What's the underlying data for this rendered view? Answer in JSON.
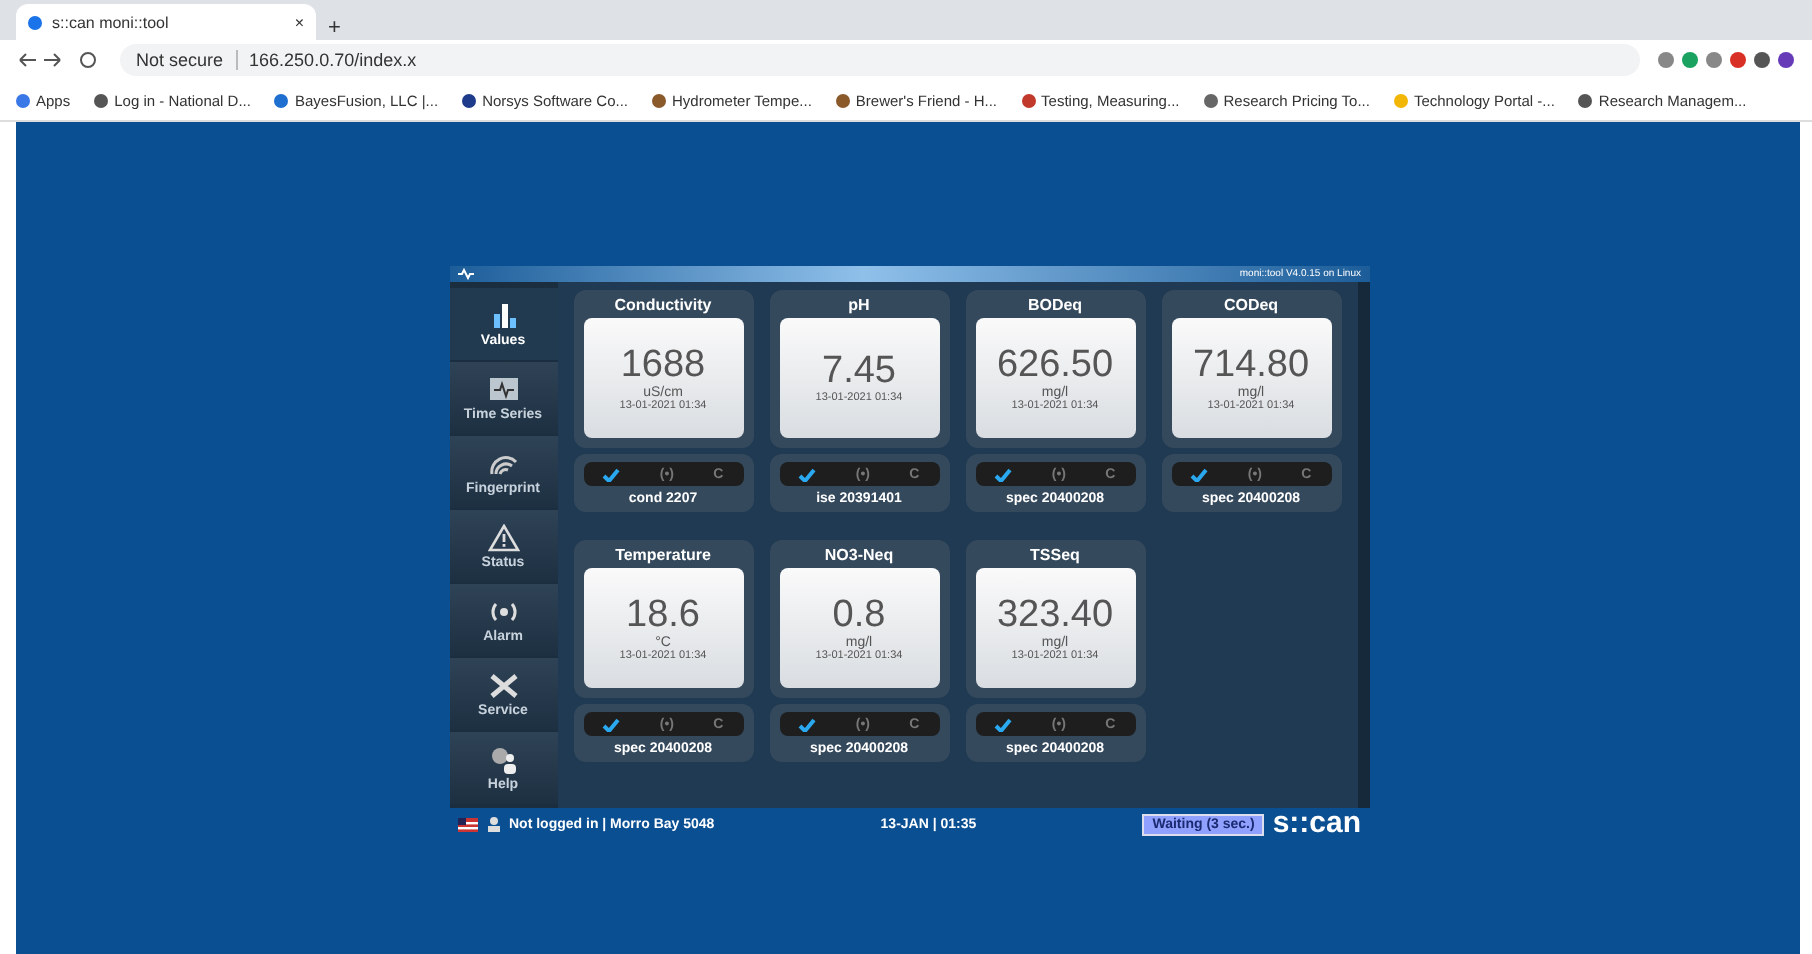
{
  "browser": {
    "tab_title": "s::can moni::tool",
    "tab_close": "×",
    "new_tab": "+",
    "security": "Not secure",
    "url": "166.250.0.70/index.x",
    "bookmarks": [
      "Apps",
      "Log in - National D...",
      "BayesFusion, LLC |...",
      "Norsys Software Co...",
      "Hydrometer Tempe...",
      "Brewer's Friend - H...",
      "Testing, Measuring...",
      "Research Pricing To...",
      "Technology Portal -...",
      "Research Managem..."
    ]
  },
  "app": {
    "version": "moni::tool V4.0.15 on Linux",
    "sidebar": [
      {
        "label": "Values",
        "selected": true
      },
      {
        "label": "Time Series",
        "selected": false
      },
      {
        "label": "Fingerprint",
        "selected": false
      },
      {
        "label": "Status",
        "selected": false
      },
      {
        "label": "Alarm",
        "selected": false
      },
      {
        "label": "Service",
        "selected": false
      },
      {
        "label": "Help",
        "selected": false
      }
    ],
    "parameters": [
      {
        "name": "Conductivity",
        "value": "1688",
        "unit": "uS/cm",
        "time": "13-01-2021 01:34",
        "sensor": "cond 2207",
        "checked": true,
        "signal": "(•)",
        "calibrate": "C"
      },
      {
        "name": "pH",
        "value": "7.45",
        "time": "13-01-2021 01:34",
        "sensor": "ise 20391401",
        "checked": true,
        "signal": "(•)",
        "calibrate": "C"
      },
      {
        "name": "BODeq",
        "value": "626.50",
        "unit": "mg/l",
        "time": "13-01-2021 01:34",
        "sensor": "spec 20400208",
        "checked": true,
        "signal": "(•)",
        "calibrate": "C"
      },
      {
        "name": "CODeq",
        "value": "714.80",
        "unit": "mg/l",
        "time": "13-01-2021 01:34",
        "sensor": "spec 20400208",
        "checked": true,
        "signal": "(•)",
        "calibrate": "C"
      },
      {
        "name": "Temperature",
        "value": "18.6",
        "unit": "°C",
        "time": "13-01-2021 01:34",
        "sensor": "spec 20400208",
        "checked": true,
        "signal": "(•)",
        "calibrate": "C"
      },
      {
        "name": "NO3-Neq",
        "value": "0.8",
        "unit": "mg/l",
        "time": "13-01-2021 01:34",
        "sensor": "spec 20400208",
        "checked": true,
        "signal": "(•)",
        "calibrate": "C"
      },
      {
        "name": "TSSeq",
        "value": "323.40",
        "unit": "mg/l",
        "time": "13-01-2021 01:34",
        "sensor": "spec 20400208",
        "checked": true,
        "signal": "(•)",
        "calibrate": "C"
      }
    ],
    "status": {
      "login": "Not logged in | Morro Bay 5048",
      "datetime": "13-JAN | 01:35",
      "waiting": "Waiting (3 sec.)",
      "logo": "s::can"
    }
  }
}
